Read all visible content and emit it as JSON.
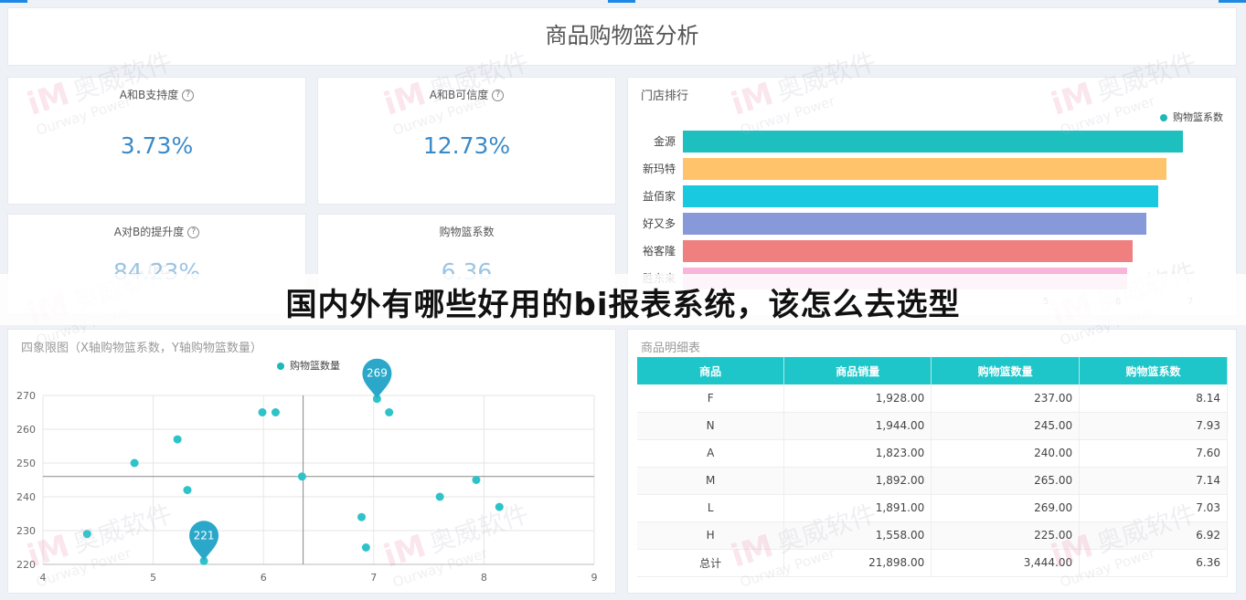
{
  "page_title": "商品购物篮分析",
  "overlay_caption": "国内外有哪些好用的bi报表系统，该怎么去选型",
  "watermark": {
    "cn": "奥威软件",
    "en": "Ourway Power"
  },
  "kpis": [
    {
      "label": "A和B支持度",
      "value": "3.73%",
      "help": "?"
    },
    {
      "label": "A和B可信度",
      "value": "12.73%",
      "help": "?"
    },
    {
      "label": "A对B的提升度",
      "value": "84.23%",
      "help": "?"
    },
    {
      "label": "购物篮系数",
      "value": "6.36",
      "help": ""
    }
  ],
  "store_ranking": {
    "title": "门店排行",
    "legend": "购物篮系数",
    "stores": [
      "金源",
      "新玛特",
      "益佰家",
      "好又多",
      "裕客隆",
      "胜东来"
    ],
    "values": [
      6.88,
      6.66,
      6.55,
      6.38,
      6.19,
      6.12
    ],
    "colors": [
      "#1ebfbf",
      "#ffc36b",
      "#19c9e0",
      "#8799d9",
      "#f08080",
      "#f8b4d9"
    ],
    "ticks": [
      "5",
      "6",
      "7"
    ]
  },
  "quadrant": {
    "title": "四象限图（X轴购物篮系数，Y轴购物篮数量）",
    "legend": "购物篮数量",
    "x_ticks": [
      "4",
      "5",
      "6",
      "7",
      "8",
      "9"
    ],
    "y_ticks": [
      "270",
      "260",
      "250",
      "240",
      "230",
      "220"
    ],
    "max_pin": "269",
    "min_pin": "221"
  },
  "chart_data": [
    {
      "type": "bar",
      "title": "门店排行",
      "categories": [
        "金源",
        "新玛特",
        "益佰家",
        "好又多",
        "裕客隆",
        "胜东来"
      ],
      "series": [
        {
          "name": "购物篮系数",
          "values": [
            6.88,
            6.66,
            6.55,
            6.38,
            6.19,
            6.12
          ]
        }
      ],
      "xlim": [
        0,
        7.5
      ],
      "legend": "top-right"
    },
    {
      "type": "scatter",
      "title": "四象限图（X轴购物篮系数，Y轴购物篮数量）",
      "series": [
        {
          "name": "购物篮数量",
          "points": [
            [
              4.4,
              229
            ],
            [
              4.83,
              250
            ],
            [
              5.22,
              257
            ],
            [
              5.31,
              242
            ],
            [
              5.46,
              221
            ],
            [
              5.99,
              265
            ],
            [
              6.11,
              265
            ],
            [
              6.35,
              246
            ],
            [
              6.89,
              234
            ],
            [
              6.93,
              225
            ],
            [
              7.03,
              269
            ],
            [
              7.14,
              265
            ],
            [
              7.6,
              240
            ],
            [
              7.93,
              245
            ],
            [
              8.14,
              237
            ]
          ]
        }
      ],
      "xlim": [
        4,
        9
      ],
      "ylim": [
        220,
        270
      ],
      "reference_lines": {
        "x": 6.36,
        "y": 246
      },
      "legend": "top-center"
    }
  ],
  "detail_table": {
    "title": "商品明细表",
    "headers": [
      "商品",
      "商品销量",
      "购物篮数量",
      "购物篮系数"
    ],
    "rows": [
      [
        "F",
        "1,928.00",
        "237.00",
        "8.14"
      ],
      [
        "N",
        "1,944.00",
        "245.00",
        "7.93"
      ],
      [
        "A",
        "1,823.00",
        "240.00",
        "7.60"
      ],
      [
        "M",
        "1,892.00",
        "265.00",
        "7.14"
      ],
      [
        "L",
        "1,891.00",
        "269.00",
        "7.03"
      ],
      [
        "H",
        "1,558.00",
        "225.00",
        "6.92"
      ]
    ],
    "total": [
      "总计",
      "21,898.00",
      "3,444.00",
      "6.36"
    ]
  }
}
